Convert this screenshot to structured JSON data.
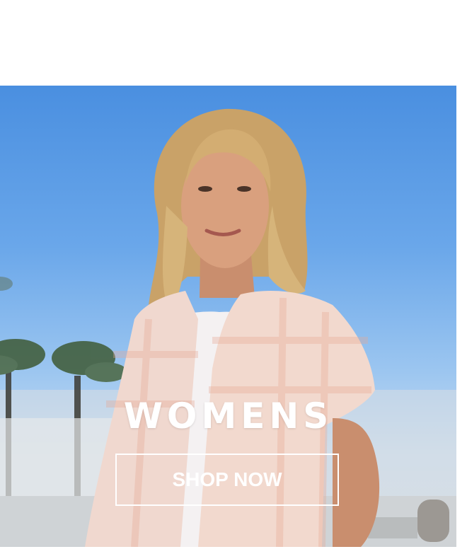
{
  "banner": {
    "category": "WOMENS",
    "cta_label": "SHOP NOW"
  },
  "colors": {
    "sky_top": "#4a8fe0",
    "sky_bottom": "#c9dcee",
    "text": "#ffffff",
    "button_border": "#ffffff"
  },
  "image": {
    "subject": "woman-in-pink-plaid-shirt-photo"
  }
}
